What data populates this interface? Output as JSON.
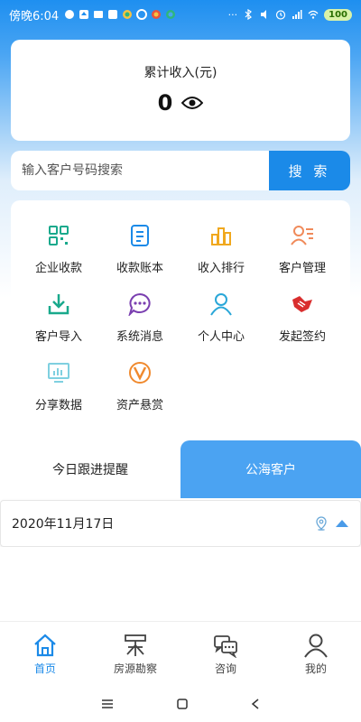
{
  "status_bar": {
    "time": "傍晚6:04",
    "battery": "100",
    "dots": "···"
  },
  "income": {
    "label": "累计收入(元)",
    "value": "0"
  },
  "search": {
    "placeholder": "输入客户号码搜索",
    "button": "搜 索"
  },
  "grid": [
    {
      "label": "企业收款",
      "icon": "qr-code-icon",
      "color": "#19a98c"
    },
    {
      "label": "收款账本",
      "icon": "ledger-icon",
      "color": "#1b8ae8"
    },
    {
      "label": "收入排行",
      "icon": "ranking-bars-icon",
      "color": "#f0a81e"
    },
    {
      "label": "客户管理",
      "icon": "user-list-icon",
      "color": "#f08a5a"
    },
    {
      "label": "客户导入",
      "icon": "download-icon",
      "color": "#19a98c"
    },
    {
      "label": "系统消息",
      "icon": "chat-bubble-icon",
      "color": "#7a3fb0"
    },
    {
      "label": "个人中心",
      "icon": "person-icon",
      "color": "#2aa7d8"
    },
    {
      "label": "发起签约",
      "icon": "handshake-icon",
      "color": "#d92e2e"
    },
    {
      "label": "分享数据",
      "icon": "monitor-chart-icon",
      "color": "#7fd0e0"
    },
    {
      "label": "资产悬赏",
      "icon": "v-circle-icon",
      "color": "#f08a2e"
    }
  ],
  "tabs": {
    "left": "今日跟进提醒",
    "right": "公海客户"
  },
  "date": {
    "text": "2020年11月17日"
  },
  "bottom_nav": [
    {
      "label": "首页",
      "icon": "home-icon",
      "active": true
    },
    {
      "label": "房源勘察",
      "icon": "survey-icon",
      "active": false
    },
    {
      "label": "咨询",
      "icon": "consult-chat-icon",
      "active": false
    },
    {
      "label": "我的",
      "icon": "profile-icon",
      "active": false
    }
  ],
  "colors": {
    "primary": "#1b8ae8",
    "tab_active": "#4ba3f2"
  }
}
